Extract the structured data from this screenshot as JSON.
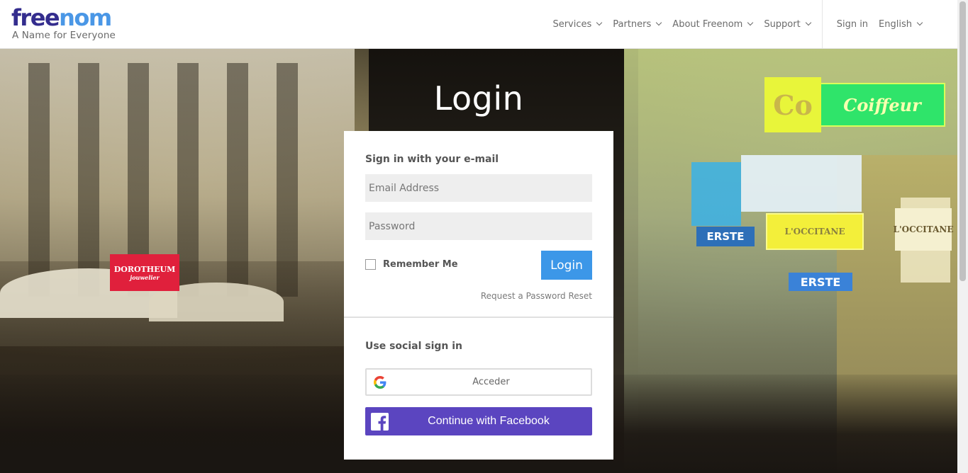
{
  "brand": {
    "logo_part1": "free",
    "logo_part2": "nom",
    "tagline": "A Name for Everyone",
    "colors": {
      "primary": "#342d8e",
      "accent": "#4a97e6"
    }
  },
  "nav": {
    "items": [
      {
        "label": "Services"
      },
      {
        "label": "Partners"
      },
      {
        "label": "About Freenom"
      },
      {
        "label": "Support"
      }
    ],
    "sign_in": "Sign in",
    "language": "English"
  },
  "login": {
    "title": "Login",
    "email_section": "Sign in with your e-mail",
    "email_placeholder": "Email Address",
    "password_placeholder": "Password",
    "remember_label": "Remember Me",
    "submit_label": "Login",
    "reset_link": "Request a Password Reset",
    "social_section": "Use social sign in",
    "google_label": "Acceder",
    "facebook_label": "Continue with Facebook",
    "colors": {
      "login_button": "#3c97e8",
      "facebook_button": "#5b45c0"
    }
  },
  "hero": {
    "signs": [
      "DOROTHEUM",
      "jouwelier",
      "Coiffeur",
      "ERSTE",
      "L'OCCITANE",
      "ERSTE",
      "L'OCCITANE",
      "Co"
    ]
  }
}
